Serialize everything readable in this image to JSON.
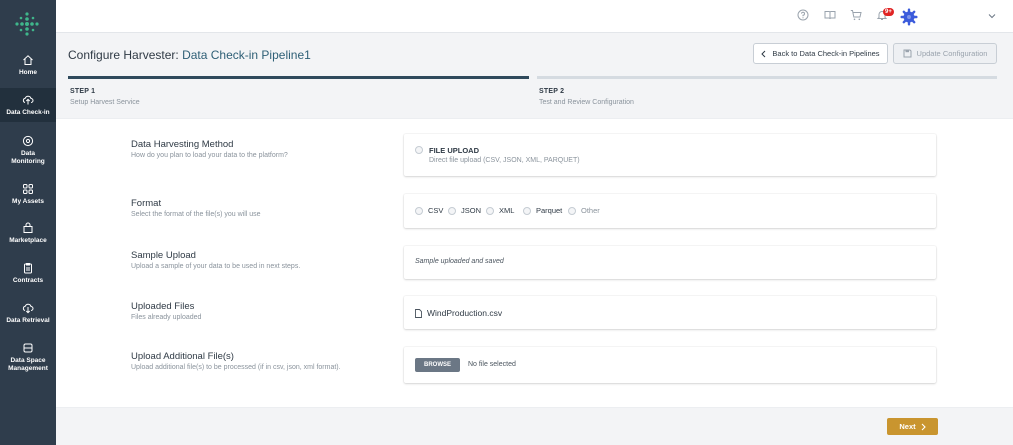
{
  "sidebar": {
    "items": [
      {
        "label": "Home",
        "icon": "home-icon"
      },
      {
        "label": "Data Check-in",
        "icon": "upload-cloud-icon"
      },
      {
        "label": "Data Monitoring",
        "icon": "monitoring-icon"
      },
      {
        "label": "My Assets",
        "icon": "grid-icon"
      },
      {
        "label": "Marketplace",
        "icon": "shopping-bag-icon"
      },
      {
        "label": "Contracts",
        "icon": "clipboard-icon"
      },
      {
        "label": "Data Retrieval",
        "icon": "download-cloud-icon"
      },
      {
        "label": "Data Space Management",
        "icon": "database-icon"
      }
    ],
    "active": "Data Check-in"
  },
  "topbar": {
    "icons": [
      "help-icon",
      "book-icon",
      "cart-icon",
      "notification-icon",
      "settings-gear-icon",
      "chevron-down-icon"
    ],
    "notification_count": "9+"
  },
  "header": {
    "title_prefix": "Configure Harvester:",
    "pipeline_name": "Data Check-in Pipeline1",
    "back_label": "Back to Data Check-in Pipelines",
    "update_label": "Update Configuration"
  },
  "steps": [
    {
      "label": "STEP 1",
      "subtitle": "Setup Harvest Service",
      "active": true
    },
    {
      "label": "STEP 2",
      "subtitle": "Test and Review Configuration",
      "active": false
    }
  ],
  "form": {
    "method": {
      "title": "Data Harvesting Method",
      "description": "How do you plan to load your data to the platform?",
      "option_title": "FILE UPLOAD",
      "option_subtitle": "Direct file upload (CSV, JSON, XML, PARQUET)"
    },
    "format": {
      "title": "Format",
      "description": "Select the format of the file(s) you will use",
      "options": [
        "CSV",
        "JSON",
        "XML",
        "Parquet",
        "Other"
      ]
    },
    "sample": {
      "title": "Sample Upload",
      "description": "Upload a sample of your data to be used in next steps.",
      "status": "Sample uploaded and saved"
    },
    "uploaded": {
      "title": "Uploaded Files",
      "description": "Files already uploaded",
      "file_name": "WindProduction.csv"
    },
    "additional": {
      "title": "Upload Additional File(s)",
      "description": "Upload additional file(s) to be processed (if in csv, json, xml format).",
      "browse_label": "BROWSE",
      "no_file_label": "No file selected"
    }
  },
  "footer": {
    "next_label": "Next"
  },
  "colors": {
    "sidebar": "#2f3d4c",
    "accent": "#c9952f",
    "step_active": "#2f4a5c",
    "logo": "#3fb68b",
    "badge": "#e02424",
    "gear": "#3b5bdb"
  }
}
